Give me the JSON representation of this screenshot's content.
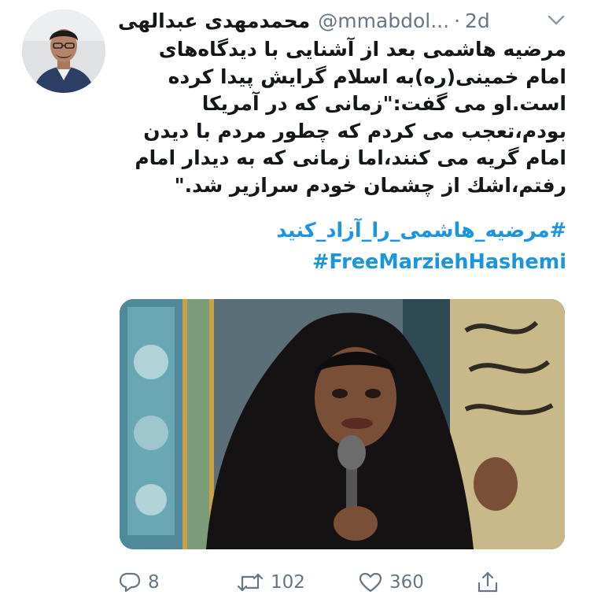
{
  "tweet": {
    "author_name": "محمدمهدی عبدالهی",
    "handle": "@mmabdol...",
    "separator": "·",
    "time": "2d",
    "text_lines": [
      "مرضیه هاشمی بعد از آشنایی با دیدگاه‌های",
      "امام خمینی(ره)به اسلام گرایش پیدا کرده",
      "است.او می گفت:\"زمانی که در آمریکا",
      "بودم،تعجب می کردم که چطور مردم با دیدن",
      "امام گریه می کنند،اما زمانی که به دیدار امام",
      "رفتم،اشك از چشمان خودم سرازیر شد.\""
    ],
    "hashtag_fa": "#مرضیه_هاشمی_را_آزاد_کنید",
    "hashtag_en": "#FreeMarziehHashemi"
  },
  "actions": {
    "reply_count": "8",
    "retweet_count": "102",
    "like_count": "360"
  },
  "icons": {
    "menu": "chevron-down-icon",
    "reply": "reply-icon",
    "retweet": "retweet-icon",
    "like": "heart-icon",
    "share": "share-icon"
  },
  "colors": {
    "link": "#1b95e0",
    "secondary": "#657786",
    "text": "#14171a"
  }
}
